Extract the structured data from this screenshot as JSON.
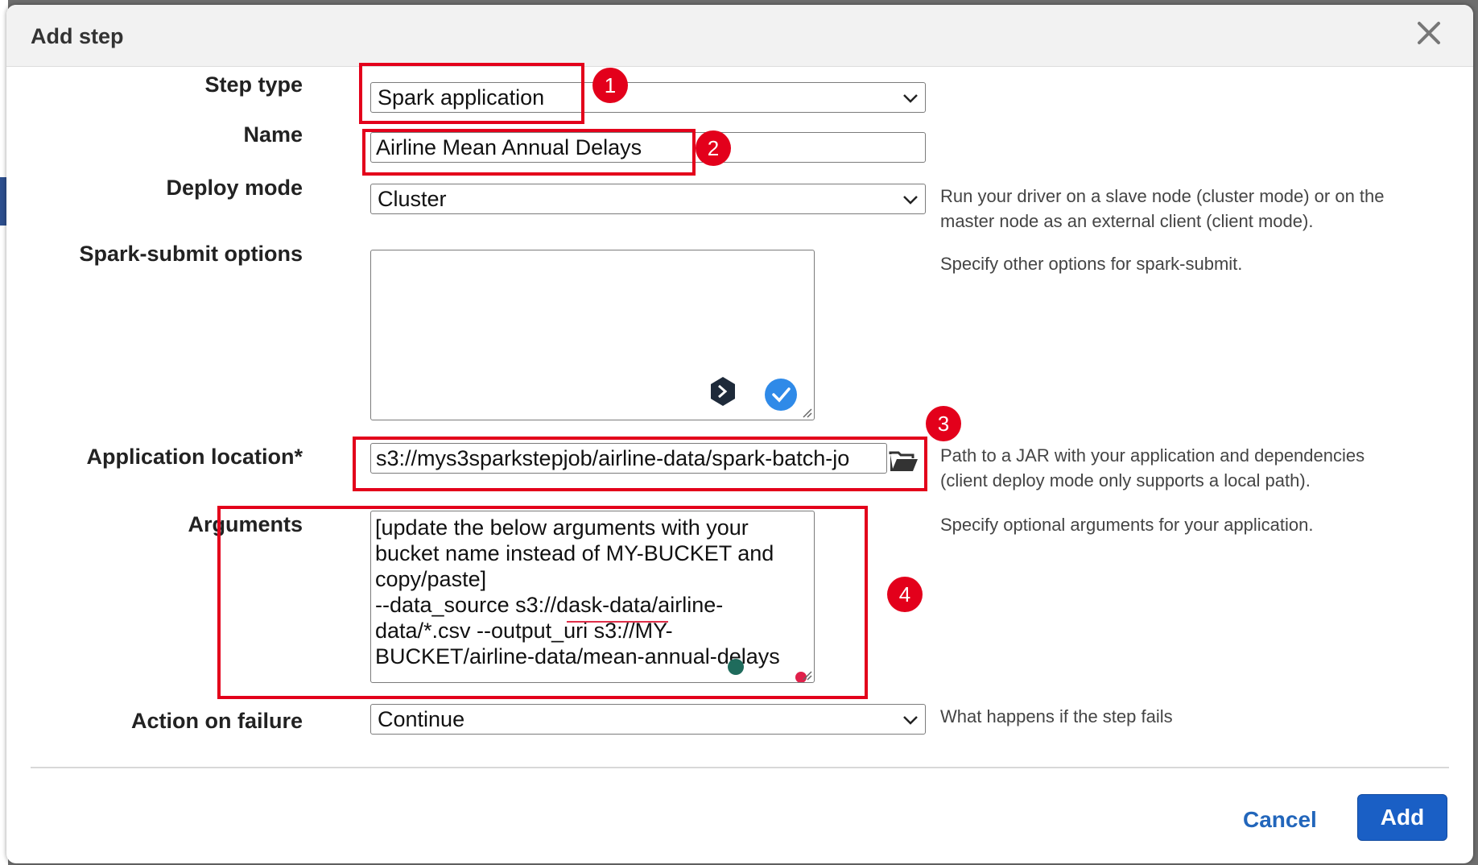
{
  "dialog": {
    "title": "Add step",
    "close_icon": "close-x-icon"
  },
  "form": {
    "step_type": {
      "label": "Step type",
      "value": "Spark application"
    },
    "name": {
      "label": "Name",
      "value": "Airline Mean Annual Delays"
    },
    "deploy_mode": {
      "label": "Deploy mode",
      "value": "Cluster",
      "help_line1": "Run your driver on a slave node (cluster mode) or on the",
      "help_line2": "master node as an external client (client mode)."
    },
    "spark_submit": {
      "label": "Spark-submit options",
      "value": "",
      "help": "Specify other options for spark-submit."
    },
    "app_location": {
      "label": "Application location*",
      "value": "s3://mys3sparkstepjob/airline-data/spark-batch-jo",
      "help_line1": "Path to a JAR with your application and dependencies",
      "help_line2": "(client deploy mode only supports a local path)."
    },
    "arguments": {
      "label": "Arguments",
      "value": "[update the below arguments with your\nbucket name instead of MY-BUCKET and\ncopy/paste]\n--data_source s3://dask-data/airline-\ndata/*.csv --output_uri s3://MY-\nBUCKET/airline-data/mean-annual-delays",
      "help": "Specify optional arguments for your application."
    },
    "action_on_failure": {
      "label": "Action on failure",
      "value": "Continue",
      "help": "What happens if the step fails"
    }
  },
  "annotations": [
    "1",
    "2",
    "3",
    "4"
  ],
  "footer": {
    "cancel_label": "Cancel",
    "add_label": "Add"
  },
  "colors": {
    "accent": "#1a5fc5",
    "annotation": "#e3001b",
    "link": "#2266bb"
  }
}
